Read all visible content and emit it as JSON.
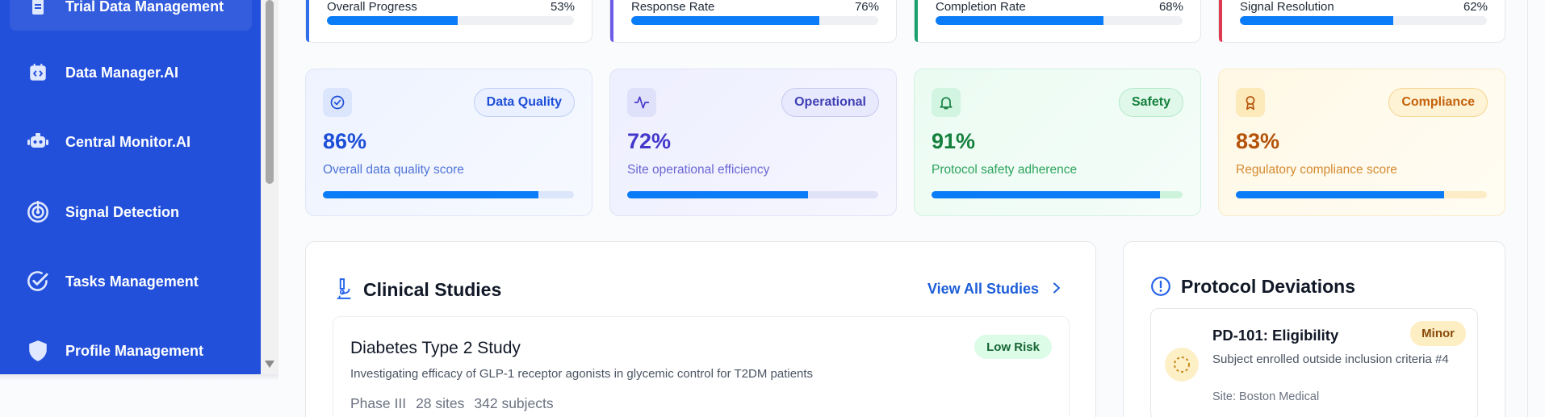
{
  "sidebar": {
    "items": [
      {
        "label": "Trial Data Management",
        "icon": "clipboard-icon"
      },
      {
        "label": "Data Manager.AI",
        "icon": "code-box-icon"
      },
      {
        "label": "Central Monitor.AI",
        "icon": "robot-icon"
      },
      {
        "label": "Signal Detection",
        "icon": "radar-icon"
      },
      {
        "label": "Tasks Management",
        "icon": "check-circle-icon"
      },
      {
        "label": "Profile Management",
        "icon": "shield-icon"
      }
    ]
  },
  "progress": [
    {
      "label": "Overall Progress",
      "value": "53%",
      "pct": 53,
      "accent": "#2f6fea"
    },
    {
      "label": "Response Rate",
      "value": "76%",
      "pct": 76,
      "accent": "#6c5ce7"
    },
    {
      "label": "Completion Rate",
      "value": "68%",
      "pct": 68,
      "accent": "#1aa06d"
    },
    {
      "label": "Signal Resolution",
      "value": "62%",
      "pct": 62,
      "accent": "#e03a50"
    }
  ],
  "metrics": [
    {
      "value": "86%",
      "pct": 86,
      "tag": "Data Quality",
      "sub": "Overall data quality score",
      "icon": "check-circle-icon"
    },
    {
      "value": "72%",
      "pct": 72,
      "tag": "Operational",
      "sub": "Site operational efficiency",
      "icon": "activity-icon"
    },
    {
      "value": "91%",
      "pct": 91,
      "tag": "Safety",
      "sub": "Protocol safety adherence",
      "icon": "bell-icon"
    },
    {
      "value": "83%",
      "pct": 83,
      "tag": "Compliance",
      "sub": "Regulatory compliance score",
      "icon": "award-icon"
    }
  ],
  "studies": {
    "title": "Clinical Studies",
    "view_all": "View All Studies",
    "card": {
      "title": "Diabetes Type 2 Study",
      "risk": "Low Risk",
      "desc": "Investigating efficacy of GLP-1 receptor agonists in glycemic control for T2DM patients",
      "phase": "Phase III",
      "sites": "28 sites",
      "subjects": "342 subjects"
    }
  },
  "deviations": {
    "title": "Protocol Deviations",
    "card": {
      "title": "PD-101: Eligibility",
      "severity": "Minor",
      "desc": "Subject enrolled outside inclusion criteria #4",
      "site": "Site: Boston Medical"
    }
  }
}
